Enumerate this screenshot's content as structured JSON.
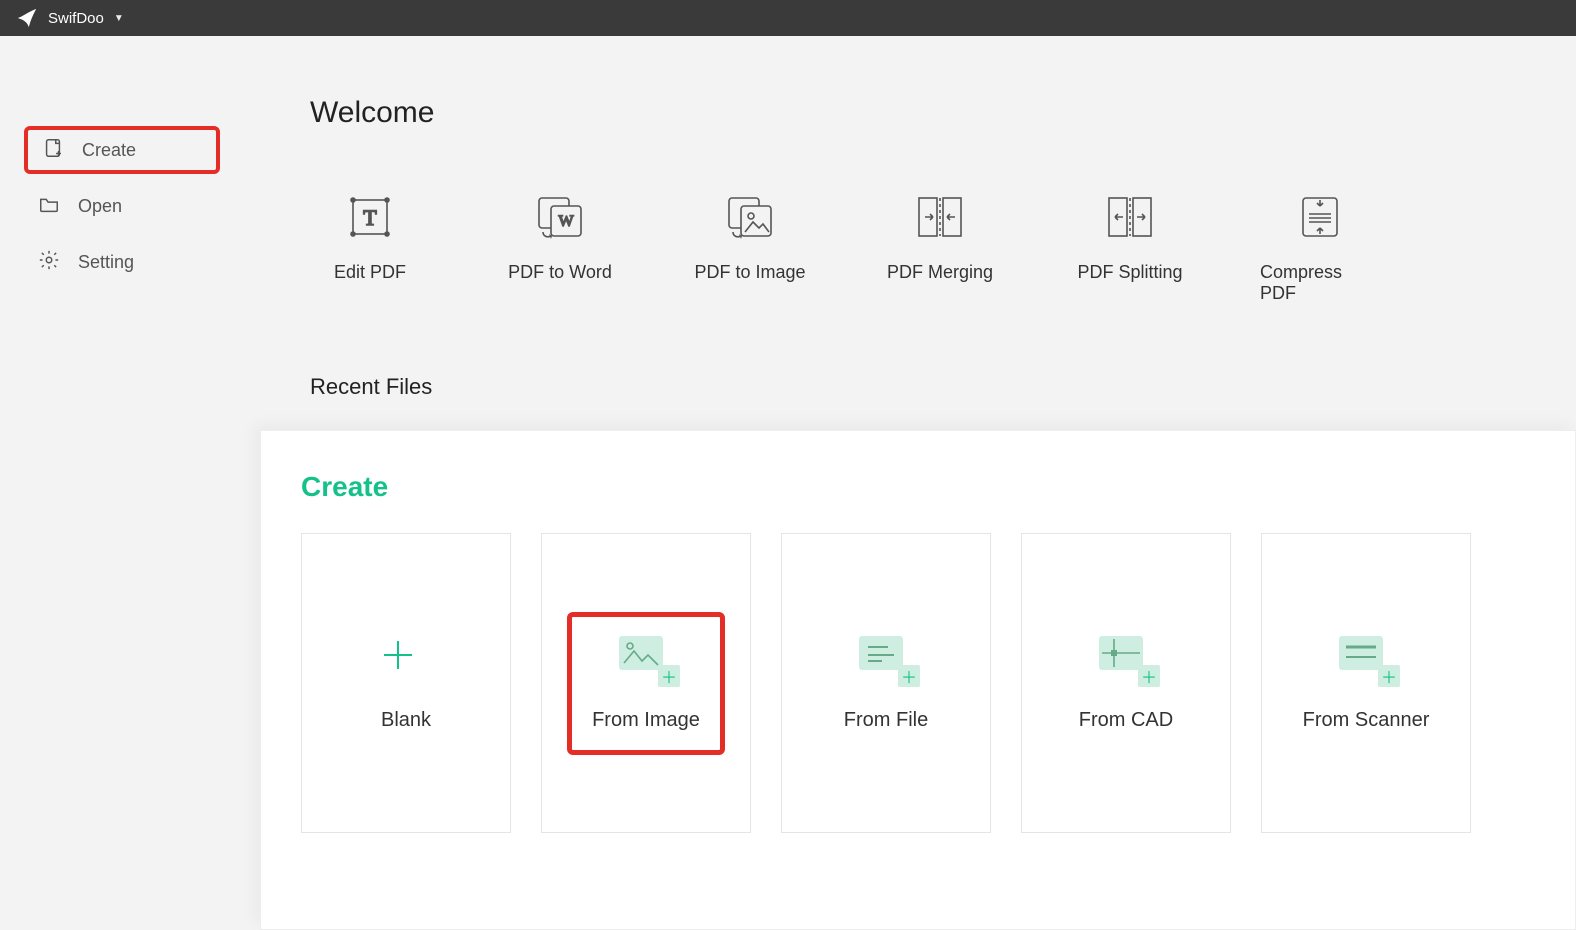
{
  "app": {
    "name": "SwifDoo"
  },
  "sidebar": {
    "create": "Create",
    "open": "Open",
    "setting": "Setting"
  },
  "content": {
    "welcome": "Welcome",
    "recent": "Recent Files",
    "tools": {
      "edit": "Edit PDF",
      "toWord": "PDF to Word",
      "toImage": "PDF to Image",
      "merge": "PDF Merging",
      "split": "PDF Splitting",
      "compress": "Compress PDF"
    },
    "createPanel": {
      "heading": "Create",
      "blank": "Blank",
      "fromImage": "From Image",
      "fromFile": "From File",
      "fromCad": "From CAD",
      "fromScanner": "From Scanner"
    }
  }
}
